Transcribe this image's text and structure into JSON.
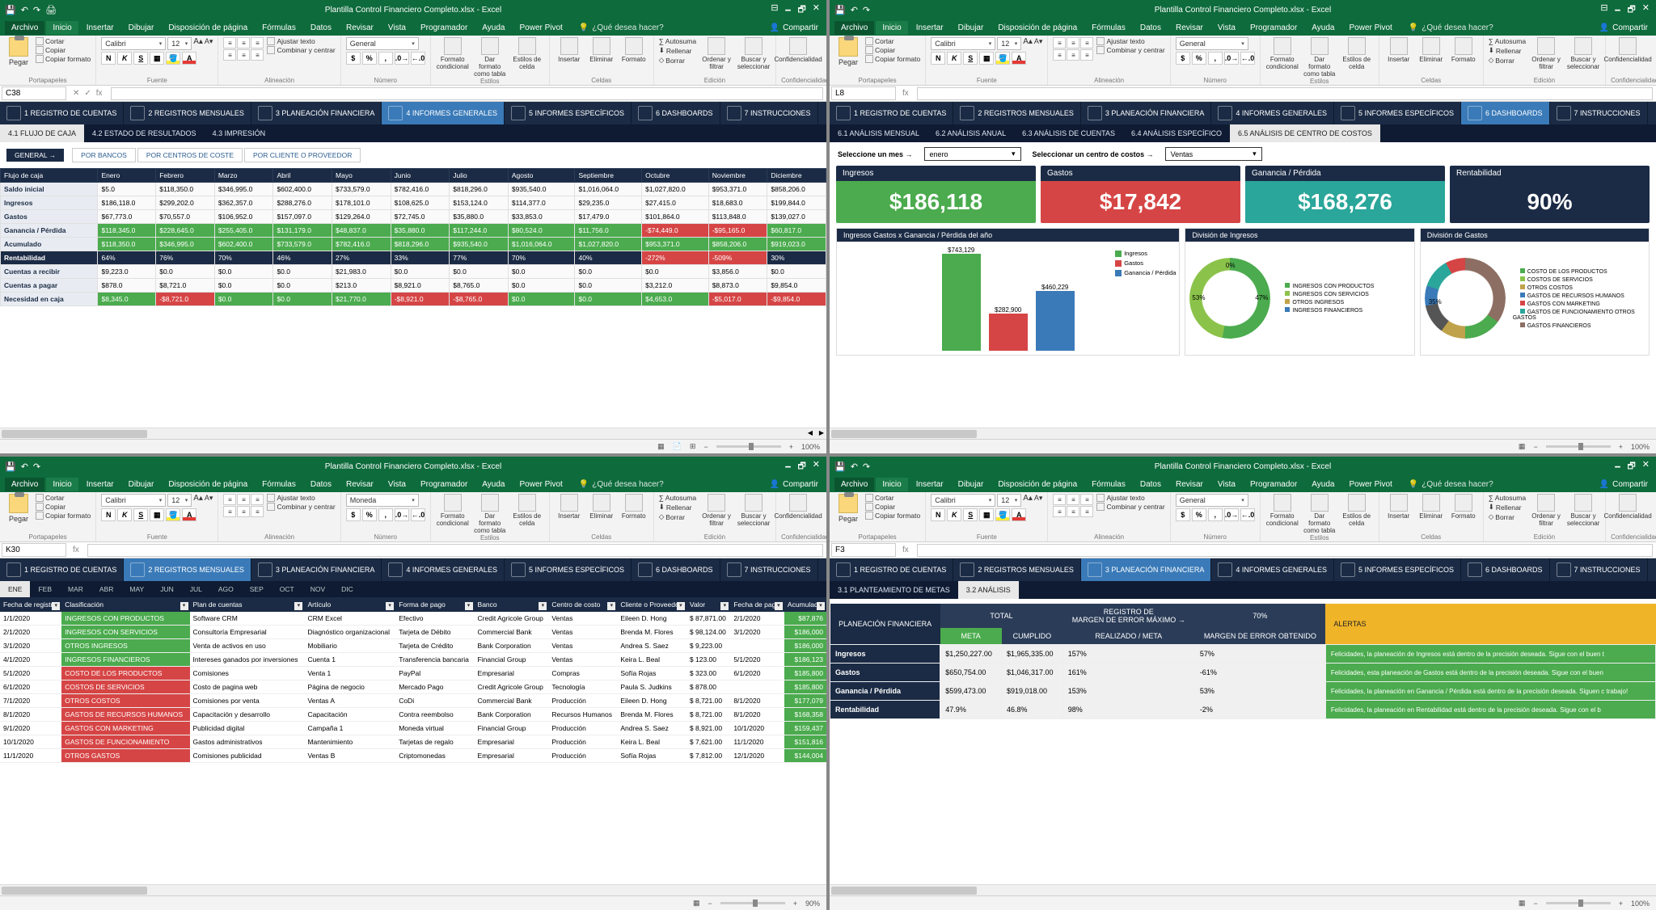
{
  "app": {
    "title": "Plantilla Control Financiero Completo.xlsx - Excel",
    "qat": [
      "💾",
      "↶",
      "↷",
      "🖨"
    ],
    "wincontrols": [
      "🗕",
      "🗗",
      "✕"
    ]
  },
  "menu": {
    "file": "Archivo",
    "tabs": [
      "Inicio",
      "Insertar",
      "Dibujar",
      "Disposición de página",
      "Fórmulas",
      "Datos",
      "Revisar",
      "Vista",
      "Programador",
      "Ayuda",
      "Power Pivot"
    ],
    "tellme": "¿Qué desea hacer?",
    "share": "Compartir"
  },
  "ribbon": {
    "paste": "Pegar",
    "cut": "Cortar",
    "copy": "Copiar",
    "fmt_painter": "Copiar formato",
    "g_clipboard": "Portapapeles",
    "font_name": "Calibri",
    "font_size": "12",
    "bold": "N",
    "italic": "K",
    "underline": "S",
    "g_font": "Fuente",
    "wrap": "Ajustar texto",
    "merge": "Combinar y centrar",
    "g_align": "Alineación",
    "num_fmt_general": "General",
    "num_fmt_moneda": "Moneda",
    "g_number": "Número",
    "cond_fmt": "Formato condicional",
    "as_table": "Dar formato como tabla",
    "cell_styles": "Estilos de celda",
    "g_styles": "Estilos",
    "insert": "Insertar",
    "delete": "Eliminar",
    "format": "Formato",
    "g_cells": "Celdas",
    "autosum": "Autosuma",
    "fill": "Rellenar",
    "clear": "Borrar",
    "sort": "Ordenar y filtrar",
    "find": "Buscar y seleccionar",
    "g_edit": "Edición",
    "sensitivity": "Confidencialidad",
    "g_sens": "Confidencialidad"
  },
  "fbar": {
    "p1_cell": "C38",
    "p2_cell": "L8",
    "p3_cell": "K30",
    "p4_cell": "F3",
    "fx": "fx"
  },
  "nav": {
    "items": [
      {
        "n": "1 REGISTRO DE CUENTAS"
      },
      {
        "n": "2 REGISTROS MENSUALES"
      },
      {
        "n": "3 PLANEACIÓN FINANCIERA"
      },
      {
        "n": "4 INFORMES GENERALES"
      },
      {
        "n": "5 INFORMES ESPECÍFICOS"
      },
      {
        "n": "6 DASHBOARDS"
      },
      {
        "n": "7 INSTRUCCIONES"
      }
    ]
  },
  "panel1": {
    "subtabs": [
      "4.1 FLUJO DE CAJA",
      "4.2 ESTADO DE RESULTADOS",
      "4.3 IMPRESIÓN"
    ],
    "general": "GENERAL →",
    "filters": [
      "POR BANCOS",
      "POR CENTROS DE COSTE",
      "POR CLIENTE O PROVEEDOR"
    ],
    "months": [
      "Enero",
      "Febrero",
      "Marzo",
      "Abril",
      "Mayo",
      "Junio",
      "Julio",
      "Agosto",
      "Septiembre",
      "Octubre",
      "Noviembre",
      "Diciembre"
    ],
    "rowh": "Flujo de caja",
    "rows": [
      {
        "label": "Saldo inicial",
        "cls": "",
        "vals": [
          "$5.0",
          "$118,350.0",
          "$346,995.0",
          "$602,400.0",
          "$733,579.0",
          "$782,416.0",
          "$818,296.0",
          "$935,540.0",
          "$1,016,064.0",
          "$1,027,820.0",
          "$953,371.0",
          "$858,206.0"
        ]
      },
      {
        "label": "Ingresos",
        "cls": "",
        "vals": [
          "$186,118.0",
          "$299,202.0",
          "$362,357.0",
          "$288,276.0",
          "$178,101.0",
          "$108,625.0",
          "$153,124.0",
          "$114,377.0",
          "$29,235.0",
          "$27,415.0",
          "$18,683.0",
          "$199,844.0"
        ]
      },
      {
        "label": "Gastos",
        "cls": "",
        "vals": [
          "$67,773.0",
          "$70,557.0",
          "$106,952.0",
          "$157,097.0",
          "$129,264.0",
          "$72,745.0",
          "$35,880.0",
          "$33,853.0",
          "$17,479.0",
          "$101,864.0",
          "$113,848.0",
          "$139,027.0"
        ]
      },
      {
        "label": "Ganancia / Pérdida",
        "cls": "green",
        "vals": [
          "$118,345.0",
          "$228,645.0",
          "$255,405.0",
          "$131,179.0",
          "$48,837.0",
          "$35,880.0",
          "$117,244.0",
          "$80,524.0",
          "$11,756.0",
          "-$74,449.0",
          "-$95,165.0",
          "$60,817.0"
        ]
      },
      {
        "label": "Acumulado",
        "cls": "green",
        "vals": [
          "$118,350.0",
          "$346,995.0",
          "$602,400.0",
          "$733,579.0",
          "$782,416.0",
          "$818,296.0",
          "$935,540.0",
          "$1,016,064.0",
          "$1,027,820.0",
          "$953,371.0",
          "$858,206.0",
          "$919,023.0"
        ]
      },
      {
        "label": "Rentabilidad",
        "cls": "darkbluehead",
        "vals": [
          "64%",
          "76%",
          "70%",
          "46%",
          "27%",
          "33%",
          "77%",
          "70%",
          "40%",
          "-272%",
          "-509%",
          "30%"
        ]
      },
      {
        "label": "Cuentas a recibir",
        "cls": "",
        "vals": [
          "$9,223.0",
          "$0.0",
          "$0.0",
          "$0.0",
          "$21,983.0",
          "$0.0",
          "$0.0",
          "$0.0",
          "$0.0",
          "$0.0",
          "$3,856.0",
          "$0.0"
        ]
      },
      {
        "label": "Cuentas a pagar",
        "cls": "",
        "vals": [
          "$878.0",
          "$8,721.0",
          "$0.0",
          "$0.0",
          "$213.0",
          "$8,921.0",
          "$8,765.0",
          "$0.0",
          "$0.0",
          "$3,212.0",
          "$8,873.0",
          "$9,854.0"
        ]
      },
      {
        "label": "Necesidad en caja",
        "cls": "green",
        "vals": [
          "$8,345.0",
          "-$8,721.0",
          "$0.0",
          "$0.0",
          "$21,770.0",
          "-$8,921.0",
          "-$8,765.0",
          "$0.0",
          "$0.0",
          "$4,653.0",
          "-$5,017.0",
          "-$9,854.0"
        ]
      }
    ]
  },
  "panel2": {
    "subtabs": [
      "6.1 ANÁLISIS MENSUAL",
      "6.2 ANÁLISIS ANUAL",
      "6.3 ANÁLISIS DE CUENTAS",
      "6.4 ANÁLISIS ESPECÍFICO",
      "6.5 ANÁLISIS DE CENTRO DE COSTOS"
    ],
    "sel_month_l": "Seleccione un mes →",
    "sel_month_v": "enero",
    "sel_cc_l": "Seleccionar un centro de costos →",
    "sel_cc_v": "Ventas",
    "kpis": [
      {
        "h": "Ingresos",
        "v": "$186,118",
        "c": "green"
      },
      {
        "h": "Gastos",
        "v": "$17,842",
        "c": "red"
      },
      {
        "h": "Ganancia / Pérdida",
        "v": "$168,276",
        "c": "teal"
      },
      {
        "h": "Rentabilidad",
        "v": "90%",
        "c": "navy"
      }
    ],
    "chart1_h": "Ingresos Gastos x Ganancia / Pérdida del año",
    "chart1_labels": [
      "$743,129",
      "$282,900",
      "$460,229"
    ],
    "chart1_legend": [
      "Ingresos",
      "Gastos",
      "Ganancia / Pérdida"
    ],
    "chart2_h": "División de Ingresos",
    "chart2_legend": [
      "INGRESOS CON PRODUCTOS",
      "INGRESOS CON SERVICIOS",
      "OTROS INGRESOS",
      "INGRESOS FINANCIEROS"
    ],
    "chart2_labels": [
      "0%",
      "47%",
      "53%"
    ],
    "chart3_h": "División de Gastos",
    "chart3_legend": [
      "COSTO DE LOS PRODUCTOS",
      "COSTOS DE SERVICIOS",
      "OTROS COSTOS",
      "GASTOS DE RECURSOS HUMANOS",
      "GASTOS CON MARKETING",
      "GASTOS DE FUNCIONAMIENTO OTROS GASTOS",
      "GASTOS FINANCIEROS"
    ],
    "chart3_label": "35%"
  },
  "chart_data": [
    {
      "type": "bar",
      "title": "Ingresos Gastos x Ganancia / Pérdida del año",
      "categories": [
        "Ingresos",
        "Gastos",
        "Ganancia / Pérdida"
      ],
      "values": [
        743129,
        282900,
        460229
      ],
      "colors": [
        "#4bab4e",
        "#d64545",
        "#3a7ab8"
      ]
    },
    {
      "type": "pie",
      "title": "División de Ingresos",
      "series": [
        {
          "name": "INGRESOS CON PRODUCTOS",
          "value": 0
        },
        {
          "name": "INGRESOS CON SERVICIOS",
          "value": 47
        },
        {
          "name": "OTROS INGRESOS",
          "value": 53
        },
        {
          "name": "INGRESOS FINANCIEROS",
          "value": 0
        }
      ]
    },
    {
      "type": "pie",
      "title": "División de Gastos",
      "series": [
        {
          "name": "COSTO DE LOS PRODUCTOS",
          "value": 35
        },
        {
          "name": "COSTOS DE SERVICIOS",
          "value": 15
        },
        {
          "name": "OTROS COSTOS",
          "value": 10
        },
        {
          "name": "GASTOS DE RECURSOS HUMANOS",
          "value": 12
        },
        {
          "name": "GASTOS CON MARKETING",
          "value": 8
        },
        {
          "name": "GASTOS DE FUNCIONAMIENTO OTROS GASTOS",
          "value": 12
        },
        {
          "name": "GASTOS FINANCIEROS",
          "value": 8
        }
      ]
    }
  ],
  "panel3": {
    "months": [
      "ENE",
      "FEB",
      "MAR",
      "ABR",
      "MAY",
      "JUN",
      "JUL",
      "AGO",
      "SEP",
      "OCT",
      "NOV",
      "DIC"
    ],
    "headers": [
      "Fecha de registro",
      "Clasificación",
      "Plan de cuentas",
      "Artículo",
      "Forma de pago",
      "Banco",
      "Centro de costo",
      "Cliente o Proveedor",
      "Valor",
      "Fecha de pago",
      "Acumulado"
    ],
    "rows": [
      {
        "d": "1/1/2020",
        "cat": "INGRESOS CON PRODUCTOS",
        "cc": "g",
        "plan": "Software CRM",
        "art": "CRM Excel",
        "fp": "Efectivo",
        "bank": "Credit Agricole Group",
        "cost": "Ventas",
        "cli": "Eileen D. Hong",
        "val": "$ 87,871.00",
        "dp": "2/1/2020",
        "acc": "$87,876"
      },
      {
        "d": "2/1/2020",
        "cat": "INGRESOS CON SERVICIOS",
        "cc": "g",
        "plan": "Consultoría Empresarial",
        "art": "Diagnóstico organizacional",
        "fp": "Tarjeta de Débito",
        "bank": "Commercial Bank",
        "cost": "Ventas",
        "cli": "Brenda M. Flores",
        "val": "$ 98,124.00",
        "dp": "3/1/2020",
        "acc": "$186,000"
      },
      {
        "d": "3/1/2020",
        "cat": "OTROS INGRESOS",
        "cc": "g",
        "plan": "Venta de activos en uso",
        "art": "Mobiliario",
        "fp": "Tarjeta de Crédito",
        "bank": "Bank Corporation",
        "cost": "Ventas",
        "cli": "Andrea S. Saez",
        "val": "$ 9,223.00",
        "dp": "",
        "acc": "$186,000"
      },
      {
        "d": "4/1/2020",
        "cat": "INGRESOS FINANCIEROS",
        "cc": "g",
        "plan": "Intereses ganados por inversiones",
        "art": "Cuenta 1",
        "fp": "Transferencia bancaria",
        "bank": "Financial Group",
        "cost": "Ventas",
        "cli": "Keira L. Beal",
        "val": "$ 123.00",
        "dp": "5/1/2020",
        "acc": "$186,123"
      },
      {
        "d": "5/1/2020",
        "cat": "COSTO DE LOS PRODUCTOS",
        "cc": "r",
        "plan": "Comisiones",
        "art": "Venta 1",
        "fp": "PayPal",
        "bank": "Empresarial",
        "cost": "Compras",
        "cli": "Sofía Rojas",
        "val": "$ 323.00",
        "dp": "6/1/2020",
        "acc": "$185,800"
      },
      {
        "d": "6/1/2020",
        "cat": "COSTOS DE SERVICIOS",
        "cc": "r",
        "plan": "Costo de pagina web",
        "art": "Página de negocio",
        "fp": "Mercado Pago",
        "bank": "Credit Agricole Group",
        "cost": "Tecnología",
        "cli": "Paula S. Judkins",
        "val": "$ 878.00",
        "dp": "",
        "acc": "$185,800"
      },
      {
        "d": "7/1/2020",
        "cat": "OTROS COSTOS",
        "cc": "r",
        "plan": "Comisiones por venta",
        "art": "Ventas A",
        "fp": "CoDi",
        "bank": "Commercial Bank",
        "cost": "Producción",
        "cli": "Eileen D. Hong",
        "val": "$ 8,721.00",
        "dp": "8/1/2020",
        "acc": "$177,079"
      },
      {
        "d": "8/1/2020",
        "cat": "GASTOS DE RECURSOS HUMANOS",
        "cc": "r",
        "plan": "Capacitación y desarrollo",
        "art": "Capacitación",
        "fp": "Contra reembolso",
        "bank": "Bank Corporation",
        "cost": "Recursos Humanos",
        "cli": "Brenda M. Flores",
        "val": "$ 8,721.00",
        "dp": "8/1/2020",
        "acc": "$168,358"
      },
      {
        "d": "9/1/2020",
        "cat": "GASTOS CON MARKETING",
        "cc": "r",
        "plan": "Publicidad digital",
        "art": "Campaña 1",
        "fp": "Moneda virtual",
        "bank": "Financial Group",
        "cost": "Producción",
        "cli": "Andrea S. Saez",
        "val": "$ 8,921.00",
        "dp": "10/1/2020",
        "acc": "$159,437"
      },
      {
        "d": "10/1/2020",
        "cat": "GASTOS DE FUNCIONAMIENTO",
        "cc": "r",
        "plan": "Gastos administrativos",
        "art": "Mantenimiento",
        "fp": "Tarjetas de regalo",
        "bank": "Empresarial",
        "cost": "Producción",
        "cli": "Keira L. Beal",
        "val": "$ 7,621.00",
        "dp": "11/1/2020",
        "acc": "$151,816"
      },
      {
        "d": "11/1/2020",
        "cat": "OTROS GASTOS",
        "cc": "r",
        "plan": "Comisiones publicidad",
        "art": "Ventas B",
        "fp": "Criptomonedas",
        "bank": "Empresarial",
        "cost": "Producción",
        "cli": "Sofía Rojas",
        "val": "$ 7,812.00",
        "dp": "12/1/2020",
        "acc": "$144,004"
      }
    ]
  },
  "panel4": {
    "subtabs": [
      "3.1 PLANTEAMIENTO DE METAS",
      "3.2 ANÁLISIS"
    ],
    "corner": "PLANEACIÓN FINANCIERA",
    "h_total": "TOTAL",
    "h_reg": "REGISTRO DE\nMARGEN DE ERROR MÁXIMO →",
    "h_70": "70%",
    "h_alert": "ALERTAS",
    "h_meta": "META",
    "h_cump": "CUMPLIDO",
    "h_real": "REALIZADO / META",
    "h_marg": "MARGEN DE ERROR OBTENIDO",
    "rows": [
      {
        "l": "Ingresos",
        "meta": "$1,250,227.00",
        "cump": "$1,965,335.00",
        "real": "157%",
        "marg": "57%",
        "msg": "Felicidades, la planeación de Ingresos está dentro de la precisión deseada. Sigue con el buen t"
      },
      {
        "l": "Gastos",
        "meta": "$650,754.00",
        "cump": "$1,046,317.00",
        "real": "161%",
        "marg": "-61%",
        "msg": "Felicidades, esta planeación de Gastos está dentro de la precisión deseada. Sigue con el buen"
      },
      {
        "l": "Ganancia / Pérdida",
        "meta": "$599,473.00",
        "cump": "$919,018.00",
        "real": "153%",
        "marg": "53%",
        "msg": "Felicidades, la planeación en Ganancia / Pérdida está dentro de la precisión deseada. Siguen c trabajo!"
      },
      {
        "l": "Rentabilidad",
        "meta": "47.9%",
        "cump": "46.8%",
        "real": "98%",
        "marg": "-2%",
        "msg": "Felicidades, la planeación en Rentabilidad está dentro de la precisión deseada. Sigue con el b"
      }
    ]
  },
  "status": {
    "zoom": "100%",
    "zoom3": "90%"
  }
}
